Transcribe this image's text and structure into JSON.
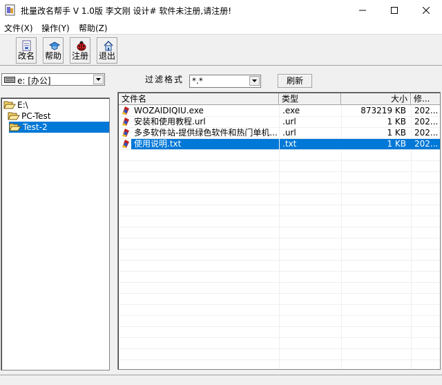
{
  "window": {
    "title": "批量改名帮手  V 1.0版  李文刚 设计#  软件未注册,请注册!",
    "controls": [
      "minimize",
      "maximize",
      "close"
    ]
  },
  "menu": [
    {
      "label": "文件(X)"
    },
    {
      "label": "操作(Y)"
    },
    {
      "label": "帮助(Z)"
    }
  ],
  "toolbar": [
    {
      "label": "改名",
      "icon": "rename-icon"
    },
    {
      "label": "帮助",
      "icon": "help-icon"
    },
    {
      "label": "注册",
      "icon": "ladybug-icon"
    },
    {
      "label": "退出",
      "icon": "exit-icon"
    }
  ],
  "drive": {
    "value": "e: [办公]"
  },
  "tree": [
    {
      "label": "E:\\",
      "depth": 0,
      "open": true,
      "selected": false
    },
    {
      "label": "PC-Test",
      "depth": 1,
      "open": true,
      "selected": false
    },
    {
      "label": "Test-2",
      "depth": 2,
      "open": true,
      "selected": true
    }
  ],
  "filter": {
    "label": "过滤格式",
    "value": "*.*",
    "refresh_label": "刷新"
  },
  "list": {
    "columns": [
      "文件名",
      "类型",
      "大小",
      "修..."
    ],
    "rows": [
      {
        "name": "WOZAIDIQIU.exe",
        "type": ".exe",
        "size": "873219 KB",
        "modified": "202...",
        "selected": false
      },
      {
        "name": "安装和使用教程.url",
        "type": ".url",
        "size": "1 KB",
        "modified": "202...",
        "selected": false
      },
      {
        "name": "多多软件站-提供绿色软件和热门单机...",
        "type": ".url",
        "size": "1 KB",
        "modified": "202...",
        "selected": false
      },
      {
        "name": "使用说明.txt",
        "type": ".txt",
        "size": "1 KB",
        "modified": "202...",
        "selected": true
      }
    ]
  },
  "colors": {
    "selection": "#0078d7",
    "window_bg": "#f0f0f0"
  }
}
